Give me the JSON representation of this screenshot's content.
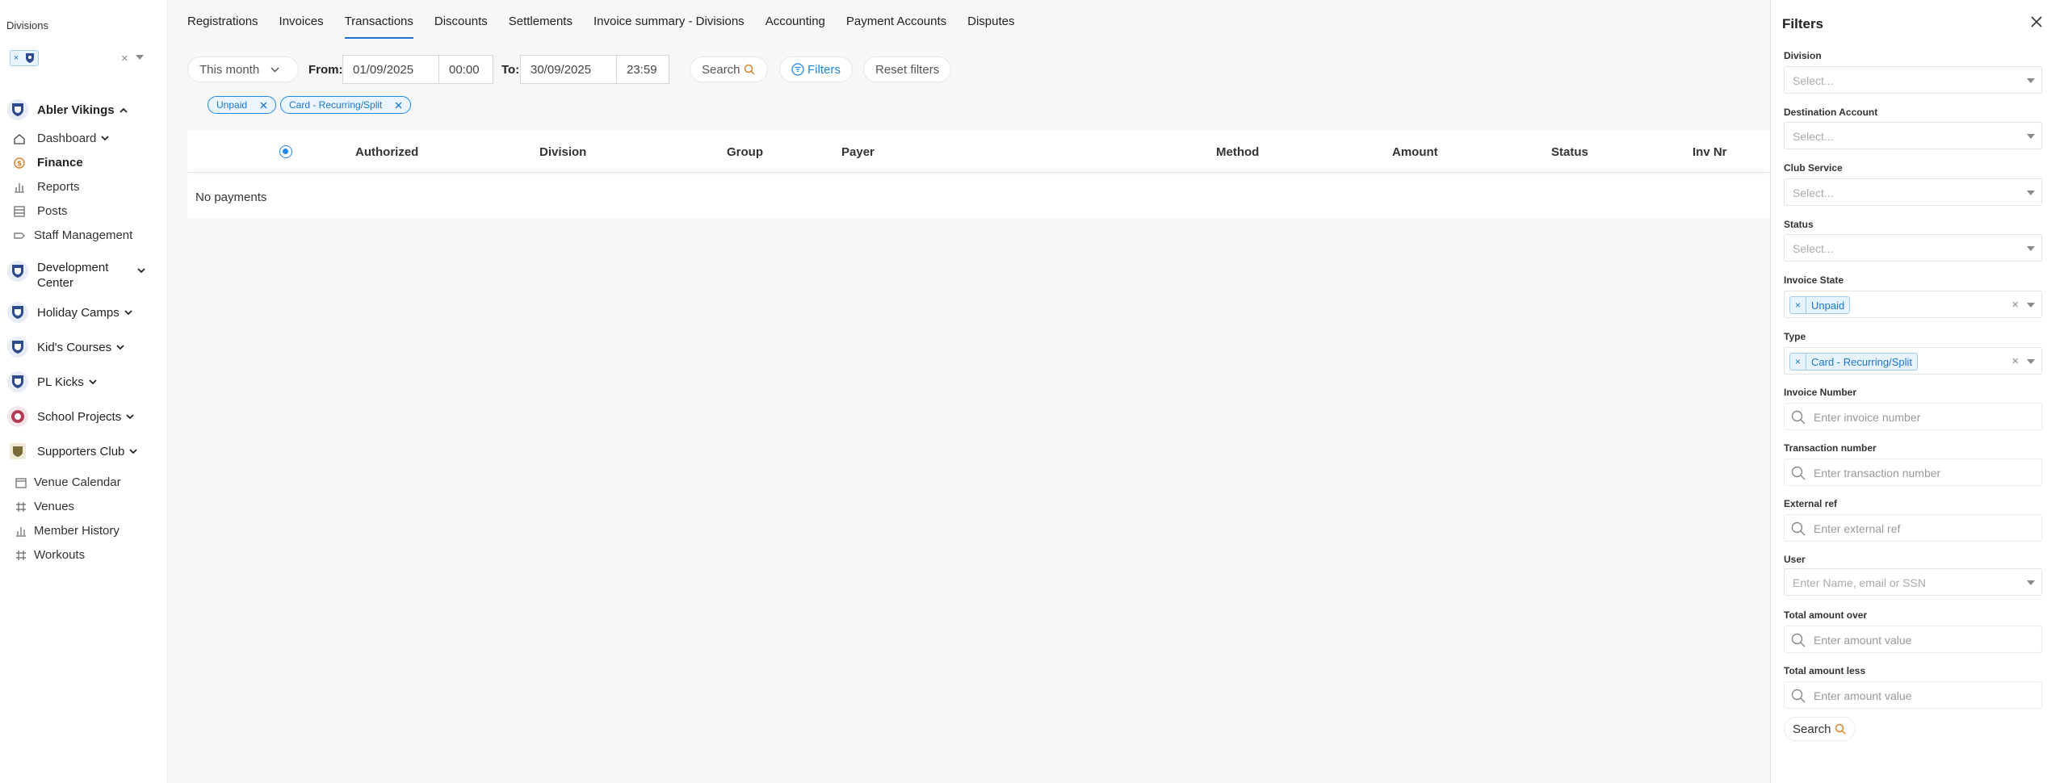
{
  "sidebar": {
    "divisions_label": "Divisions",
    "division_chip_x": "×",
    "division_clear": "×",
    "clubs": [
      {
        "label": "Abler Vikings"
      },
      {
        "label": "Development Center"
      },
      {
        "label": "Holiday Camps"
      },
      {
        "label": "Kid's Courses"
      },
      {
        "label": "PL Kicks"
      },
      {
        "label": "School Projects"
      },
      {
        "label": "Supporters Club"
      }
    ],
    "items": [
      {
        "label": "Dashboard"
      },
      {
        "label": "Finance"
      },
      {
        "label": "Reports"
      },
      {
        "label": "Posts"
      },
      {
        "label": "Staff Management"
      }
    ],
    "bottom_items": [
      {
        "label": "Venue Calendar"
      },
      {
        "label": "Venues"
      },
      {
        "label": "Member History"
      },
      {
        "label": "Workouts"
      }
    ],
    "dev_center_line1": "Development",
    "dev_center_line2": "Center"
  },
  "tabs": [
    {
      "label": "Registrations"
    },
    {
      "label": "Invoices"
    },
    {
      "label": "Transactions",
      "active": true
    },
    {
      "label": "Discounts"
    },
    {
      "label": "Settlements"
    },
    {
      "label": "Invoice summary - Divisions"
    },
    {
      "label": "Accounting"
    },
    {
      "label": "Payment Accounts"
    },
    {
      "label": "Disputes"
    }
  ],
  "toolbar": {
    "period": "This month",
    "from_label": "From:",
    "from_date": "01/09/2025",
    "from_time": "00:00",
    "to_label": "To:",
    "to_date": "30/09/2025",
    "to_time": "23:59",
    "search": "Search",
    "filters": "Filters",
    "reset": "Reset filters"
  },
  "active_tags": [
    {
      "label": "Unpaid"
    },
    {
      "label": "Card - Recurring/Split"
    }
  ],
  "table": {
    "columns": [
      "Authorized",
      "Division",
      "Group",
      "Payer",
      "Method",
      "Amount",
      "Status",
      "Inv Nr"
    ],
    "empty": "No payments"
  },
  "filters": {
    "title": "Filters",
    "division": {
      "label": "Division",
      "placeholder": "Select..."
    },
    "destination": {
      "label": "Destination Account",
      "placeholder": "Select..."
    },
    "club_service": {
      "label": "Club Service",
      "placeholder": "Select..."
    },
    "status": {
      "label": "Status",
      "placeholder": "Select..."
    },
    "invoice_state": {
      "label": "Invoice State",
      "chip": "Unpaid"
    },
    "type": {
      "label": "Type",
      "chip": "Card - Recurring/Split"
    },
    "invoice_number": {
      "label": "Invoice Number",
      "placeholder": "Enter invoice number"
    },
    "transaction_number": {
      "label": "Transaction number",
      "placeholder": "Enter transaction number"
    },
    "external_ref": {
      "label": "External ref",
      "placeholder": "Enter external ref"
    },
    "user": {
      "label": "User",
      "placeholder": "Enter Name, email or SSN"
    },
    "amount_over": {
      "label": "Total amount over",
      "placeholder": "Enter amount value"
    },
    "amount_less": {
      "label": "Total amount less",
      "placeholder": "Enter amount value"
    },
    "search": "Search",
    "chip_x": "×",
    "clear": "×"
  },
  "colors": {
    "accent": "#1e88e5",
    "brand_orange": "#d9822b"
  }
}
